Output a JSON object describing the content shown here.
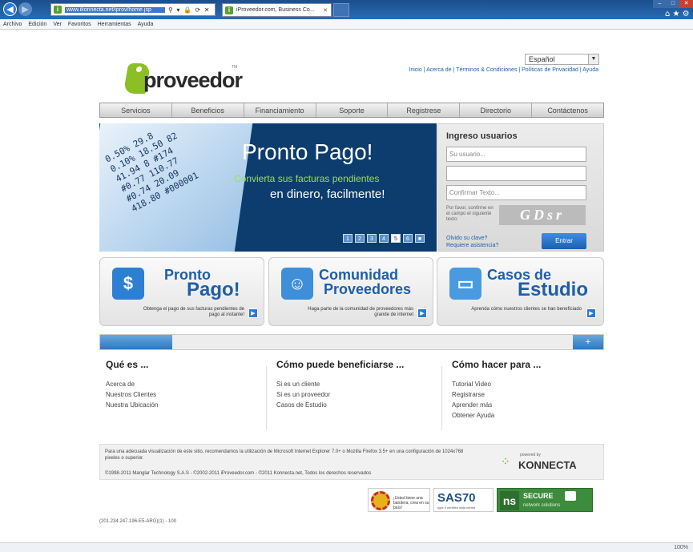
{
  "browser": {
    "url": "www.ikonnecta.net/iprov/home.jsp",
    "addr_tools": "⚲ ▾ 🔒 ⟳ ✕",
    "tab_title": "iProveedor.com, Business Co...",
    "menu": [
      "Archivo",
      "Edición",
      "Ver",
      "Favoritos",
      "Herramientas",
      "Ayuda"
    ],
    "zoom": "100%"
  },
  "header": {
    "logo_text": "proveedor",
    "logo_tm": "TM",
    "language": "Español",
    "top_links": "Inicio | Acerca de | Términos & Condiciones | Políticas de Privacidad | Ayuda"
  },
  "nav": [
    "Servicios",
    "Beneficios",
    "Financiamiento",
    "Soporte",
    "Registrese",
    "Directorio",
    "Contáctenos"
  ],
  "banner": {
    "title": "Pronto Pago!",
    "line1": "Convierta sus facturas pendientes",
    "line2": "en dinero, facilmente!",
    "pages": [
      "1",
      "2",
      "3",
      "4",
      "5",
      "6"
    ],
    "current_page": "5"
  },
  "login": {
    "title": "Ingreso usuarios",
    "user_placeholder": "Su usuario...",
    "password_value": "",
    "confirm_placeholder": "Confirmar Texto...",
    "captcha_label": "Por favor, confirme en el campo el siguiente texto:",
    "captcha_text": "GDsr",
    "forgot": "Olvido su clave?",
    "help": "Requiere asistencia?",
    "submit": "Entrar"
  },
  "cards": [
    {
      "line1": "Pronto",
      "line2": "Pago!",
      "desc": "Obtenga el pago de sus facturas pendientes de pago al instante!"
    },
    {
      "line1": "Comunidad",
      "line2": "Proveedores",
      "desc": "Haga parte de la comunidad de proveedores más grande de internet"
    },
    {
      "line1": "Casos de",
      "line2": "Estudio",
      "desc": "Aprenda cómo nuestros clientes se han beneficiado"
    }
  ],
  "columns": [
    {
      "title": "Qué es ...",
      "items": [
        "Acerca de",
        "Nuestros Clientes",
        "Nuestra Ubicación"
      ]
    },
    {
      "title": "Cómo puede beneficiarse ...",
      "items": [
        "Si es un cliente",
        "Si es un proveedor",
        "Casos de Estudio"
      ]
    },
    {
      "title": "Cómo hacer para ...",
      "items": [
        "Tutorial Video",
        "Registrarse",
        "Aprender más",
        "Obtener Ayuda"
      ]
    }
  ],
  "footer": {
    "note": "Para una adecuada visualización de este sitio, recomendamos la utilización de Microsoft Internet Explorer 7.0+ o Mozilla Firefox 3.5+ en una configuración de 1024x768 pixeles o superior.",
    "copyright": "©1998-2011 Manglar Technology S.A.S - ©2002-2011 iProveedor.com - ©2011 Konnecta.net, Todos los derechos reservados",
    "powered": "powered by",
    "konnecta": "KONNECTA"
  },
  "badges": {
    "b1": "¡Usted tiene una bandera, crea en su país!",
    "sas": "SAS70",
    "sas_sub": "type II certified data center",
    "secure": "SECURE",
    "network": "network solutions"
  },
  "ip_line": "(201.234.247.196-E5-ARG)(1) - 100"
}
